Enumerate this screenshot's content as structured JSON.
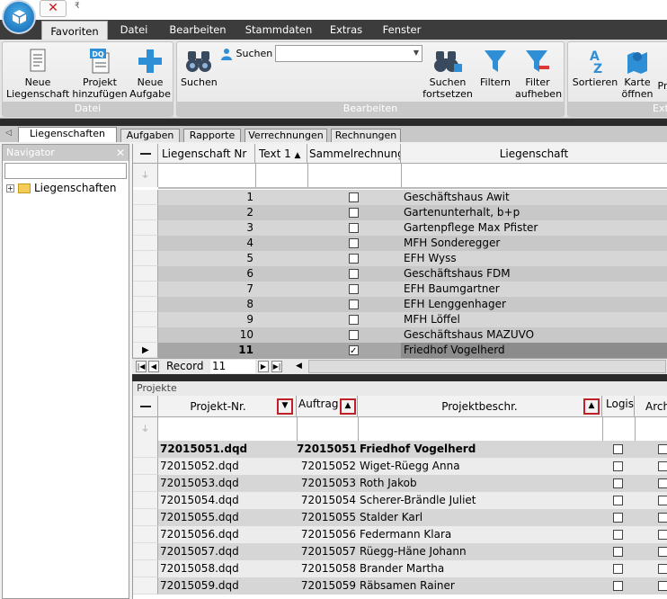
{
  "window": {
    "quickaccess_arrow": "₹",
    "close_glyph": "✕"
  },
  "menu_tabs": [
    {
      "label": "Favoriten",
      "active": true
    },
    {
      "label": "Datei"
    },
    {
      "label": "Bearbeiten"
    },
    {
      "label": "Stammdaten"
    },
    {
      "label": "Extras"
    },
    {
      "label": "Fenster"
    }
  ],
  "ribbon": {
    "groups": {
      "datei": "Datei",
      "bearbeiten": "Bearbeiten",
      "extras": "Extr"
    },
    "buttons": {
      "neue_liegenschaft": [
        "Neue",
        "Liegenschaft"
      ],
      "projekt_hinzufuegen": [
        "Projekt",
        "hinzufügen"
      ],
      "neue_aufgabe": [
        "Neue",
        "Aufgabe"
      ],
      "suchen_big": "Suchen",
      "suchen_small": "Suchen",
      "suchen_fortsetzen": [
        "Suchen",
        "fortsetzen"
      ],
      "filtern": "Filtern",
      "filter_aufheben": [
        "Filter",
        "aufheben"
      ],
      "sortieren": "Sortieren",
      "karte_oeffnen": [
        "Karte",
        "öffnen"
      ],
      "pr": "Pr"
    },
    "doc_icon_text": "DQ",
    "sort_icon_text": [
      "A",
      "Z"
    ],
    "search_value": ""
  },
  "doc_tabs": [
    {
      "label": "Liegenschaften",
      "active": true
    },
    {
      "label": "Aufgaben"
    },
    {
      "label": "Rapporte"
    },
    {
      "label": "Verrechnungen"
    },
    {
      "label": "Rechnungen"
    }
  ],
  "navigator": {
    "title": "Navigator",
    "close": "✕",
    "search_value": "",
    "tree_root": "Liegenschaften",
    "tree_expand": "+"
  },
  "grid1": {
    "columns": {
      "nr": "Liegenschaft Nr",
      "text1": "Text 1",
      "sammel": "Sammelrechnung",
      "name": "Liegenschaft"
    },
    "rows": [
      {
        "nr": "1",
        "checked": false,
        "name": "Geschäftshaus Awit"
      },
      {
        "nr": "2",
        "checked": false,
        "name": "Gartenunterhalt, b+p"
      },
      {
        "nr": "3",
        "checked": false,
        "name": "Gartenpflege Max Pfister"
      },
      {
        "nr": "4",
        "checked": false,
        "name": "MFH Sonderegger"
      },
      {
        "nr": "5",
        "checked": false,
        "name": "EFH Wyss"
      },
      {
        "nr": "6",
        "checked": false,
        "name": "Geschäftshaus FDM"
      },
      {
        "nr": "7",
        "checked": false,
        "name": "EFH Baumgartner"
      },
      {
        "nr": "8",
        "checked": false,
        "name": "EFH Lenggenhager"
      },
      {
        "nr": "9",
        "checked": false,
        "name": "MFH Löffel"
      },
      {
        "nr": "10",
        "checked": false,
        "name": "Geschäftshaus MAZUVO"
      },
      {
        "nr": "11",
        "checked": true,
        "name": "Friedhof Vogelherd",
        "current": true
      }
    ],
    "navigator": {
      "label": "Record",
      "value": "11",
      "first": "|◀",
      "prev": "◀",
      "next": "▶",
      "last": "▶|",
      "scroll_left": "◀"
    }
  },
  "grid2": {
    "title": "Projekte",
    "columns": {
      "projekt_nr": "Projekt-Nr.",
      "auftrag": "Auftrag",
      "beschr": "Projektbeschr.",
      "logis": "Logis",
      "arch": "Arch"
    },
    "rows": [
      {
        "projekt_nr": "72015051.dqd",
        "auftrag": "72015051",
        "beschr": "Friedhof Vogelherd",
        "bold": true
      },
      {
        "projekt_nr": "72015052.dqd",
        "auftrag": "72015052",
        "beschr": "Wiget-Rüegg Anna"
      },
      {
        "projekt_nr": "72015053.dqd",
        "auftrag": "72015053",
        "beschr": "Roth Jakob"
      },
      {
        "projekt_nr": "72015054.dqd",
        "auftrag": "72015054",
        "beschr": "Scherer-Brändle Juliet"
      },
      {
        "projekt_nr": "72015055.dqd",
        "auftrag": "72015055",
        "beschr": "Stalder Karl"
      },
      {
        "projekt_nr": "72015056.dqd",
        "auftrag": "72015056",
        "beschr": "Federmann Klara"
      },
      {
        "projekt_nr": "72015057.dqd",
        "auftrag": "72015057",
        "beschr": "Rüegg-Häne Johann"
      },
      {
        "projekt_nr": "72015058.dqd",
        "auftrag": "72015058",
        "beschr": "Brander Martha"
      },
      {
        "projekt_nr": "72015059.dqd",
        "auftrag": "72015059",
        "beschr": "Räbsamen Rainer"
      }
    ]
  },
  "colors": {
    "menubar": "#3c3c3c",
    "accent_blue": "#2f8fd6",
    "sort_highlight": "#c0202a",
    "row_alt": "#d6d6d6",
    "row_selected": "#a6a6a6"
  }
}
